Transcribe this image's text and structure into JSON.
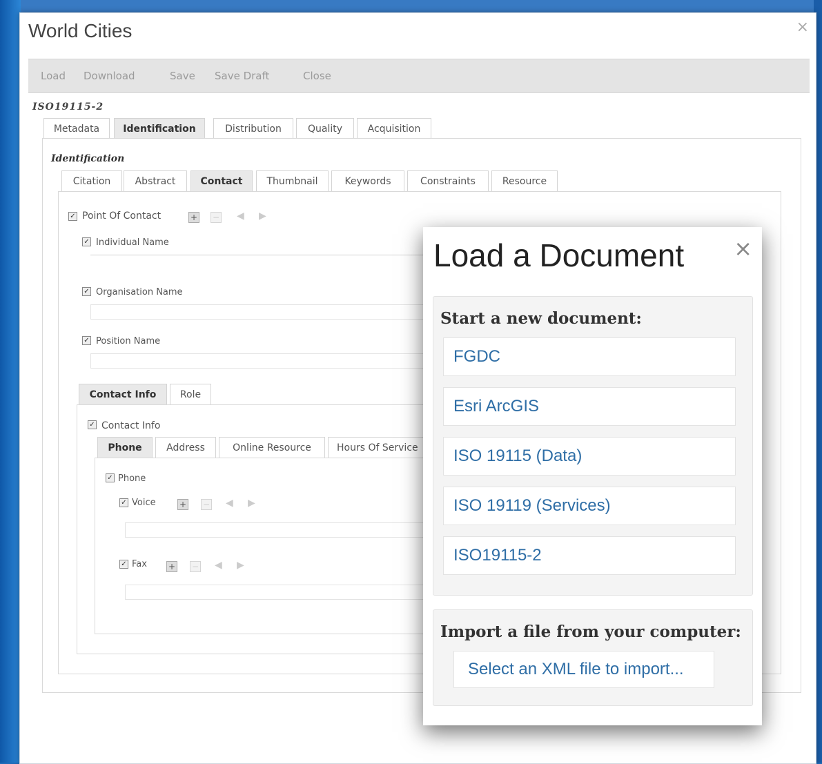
{
  "window": {
    "title": "World Cities",
    "close_glyph": "×"
  },
  "toolbar": {
    "load": "Load",
    "download": "Download",
    "save": "Save",
    "save_draft": "Save Draft",
    "close": "Close"
  },
  "standard_label": "ISO19115-2",
  "main_tabs": [
    "Metadata",
    "Identification",
    "Distribution",
    "Quality",
    "Acquisition"
  ],
  "identification": {
    "group_label": "Identification",
    "tabs": [
      "Citation",
      "Abstract",
      "Contact",
      "Thumbnail",
      "Keywords",
      "Constraints",
      "Resource"
    ]
  },
  "contact": {
    "point_of_contact": "Point Of Contact",
    "individual_name": "Individual Name",
    "organisation_name": "Organisation Name",
    "position_name": "Position Name",
    "subtabs": [
      "Contact Info",
      "Role"
    ],
    "contact_info_label": "Contact Info",
    "info_tabs": [
      "Phone",
      "Address",
      "Online Resource",
      "Hours Of Service"
    ],
    "phone_label": "Phone",
    "voice_label": "Voice",
    "fax_label": "Fax"
  },
  "modal": {
    "title": "Load a Document",
    "close_glyph": "×",
    "new_doc_title": "Start a new document:",
    "options": [
      "FGDC",
      "Esri ArcGIS",
      "ISO 19115 (Data)",
      "ISO 19119 (Services)",
      "ISO19115-2"
    ],
    "import_title": "Import a file from your computer:",
    "import_button": "Select an XML file to import..."
  },
  "colors": {
    "link": "#2f6ea6",
    "background": "#1f6bb8",
    "active_tab": "#e9e9e9"
  }
}
